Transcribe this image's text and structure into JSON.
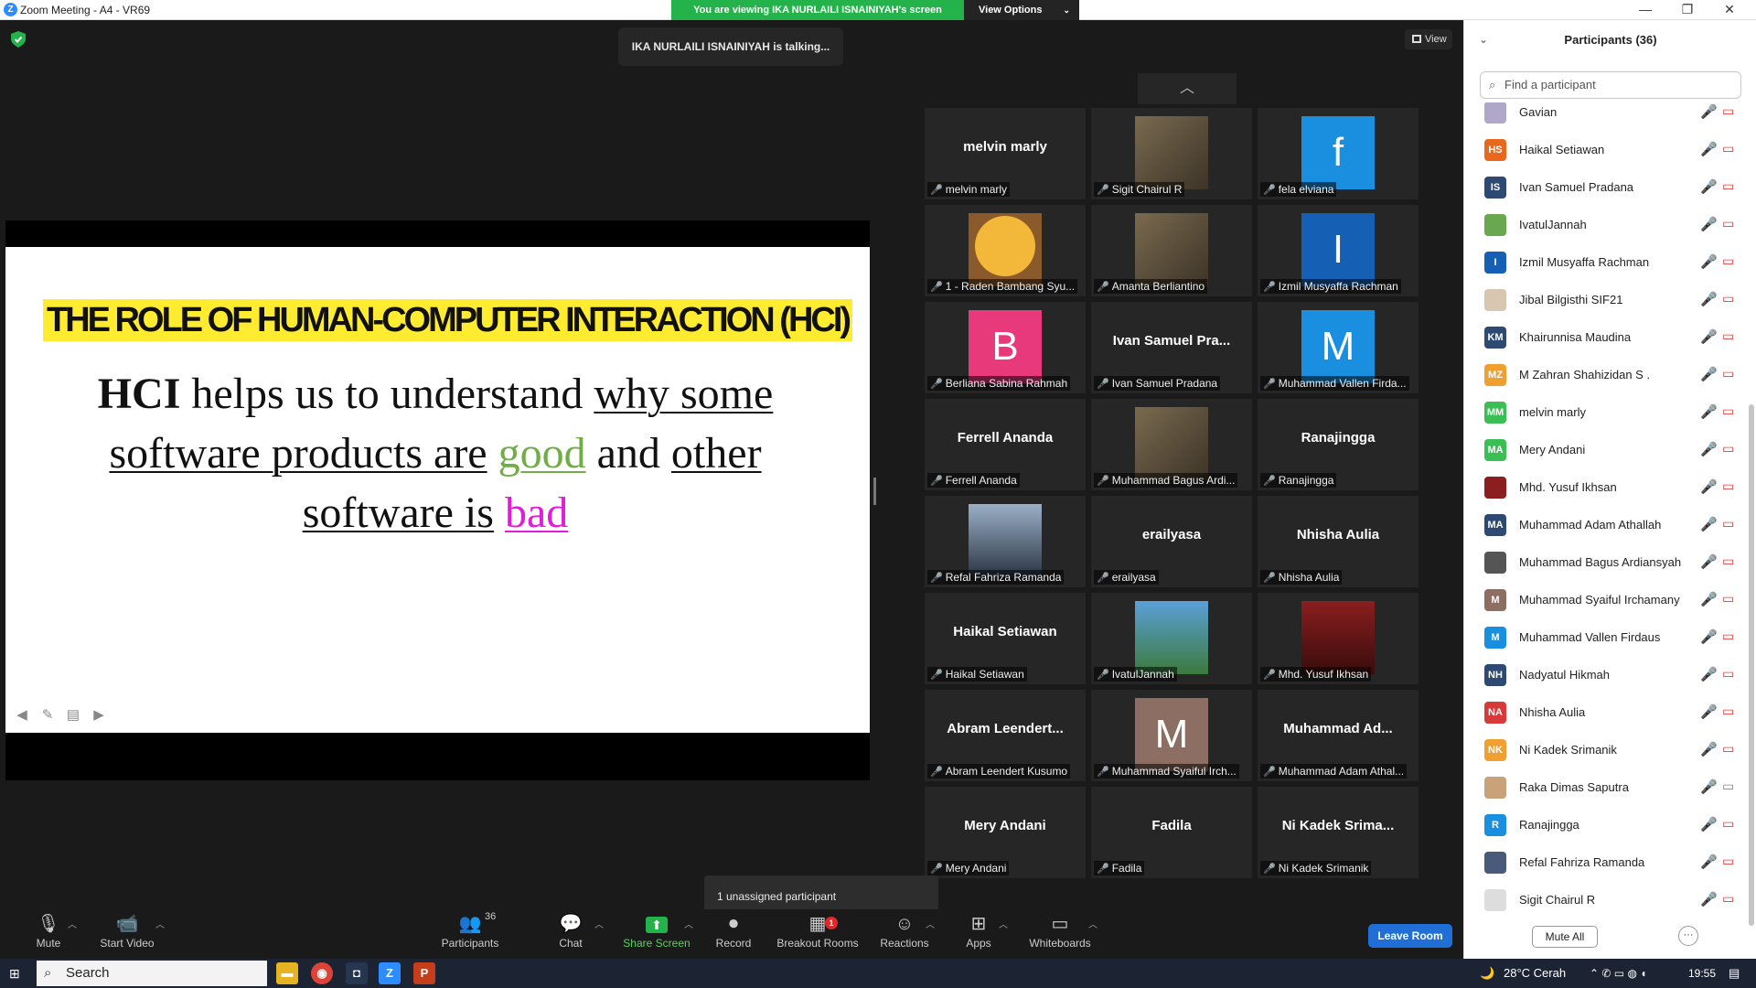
{
  "window": {
    "title": "Zoom Meeting - A4 - VR69",
    "minimize": "—",
    "restore": "❐",
    "close": "✕"
  },
  "banner": {
    "viewing": "You are viewing IKA NURLAILI ISNAINIYAH's screen",
    "view_options": "View Options"
  },
  "talking": "IKA NURLAILI ISNAINIYAH is talking...",
  "view_button": "View",
  "slide": {
    "title": "THE ROLE OF HUMAN-COMPUTER INTERACTION (HCI)",
    "body_hci": "HCI",
    "body_1": " helps us to understand ",
    "body_2": "why some software products are",
    "body_3": " ",
    "body_good": "good",
    "body_4": " and ",
    "body_5": "other software is",
    "body_6": " ",
    "body_bad": "bad",
    "colors": {
      "title_bg": "#ffec31",
      "good": "#70ad47",
      "bad": "#e31bdb"
    }
  },
  "gallery": {
    "tiles": [
      {
        "label": "melvin marly",
        "center": "melvin marly",
        "avatar": ""
      },
      {
        "label": "Sigit Chairul R",
        "center": "",
        "avatar": "photo"
      },
      {
        "label": "fela elviana",
        "center": "",
        "avatar": "f",
        "color": "#1a8fe0"
      },
      {
        "label": "1 - Raden Bambang Syu...",
        "center": "",
        "avatar": "photo-jake"
      },
      {
        "label": "Amanta Berliantino",
        "center": "",
        "avatar": "photo"
      },
      {
        "label": "Izmil Musyaffa Rachman",
        "center": "",
        "avatar": "I",
        "color": "#1560b5"
      },
      {
        "label": "Berliana Sabina Rahmah",
        "center": "",
        "avatar": "B",
        "color": "#e8397a"
      },
      {
        "label": "Ivan Samuel Pradana",
        "center": "Ivan Samuel Pra...",
        "avatar": ""
      },
      {
        "label": "Muhammad Vallen Firda...",
        "center": "",
        "avatar": "M",
        "color": "#1a8fe0"
      },
      {
        "label": "Ferrell Ananda",
        "center": "Ferrell Ananda",
        "avatar": ""
      },
      {
        "label": "Muhammad Bagus Ardi...",
        "center": "",
        "avatar": "photo"
      },
      {
        "label": "Ranajingga",
        "center": "Ranajingga",
        "avatar": ""
      },
      {
        "label": "Refal Fahriza Ramanda",
        "center": "",
        "avatar": "photo-bird"
      },
      {
        "label": "erailyasa",
        "center": "erailyasa",
        "avatar": ""
      },
      {
        "label": "Nhisha Aulia",
        "center": "Nhisha Aulia",
        "avatar": ""
      },
      {
        "label": "Haikal Setiawan",
        "center": "Haikal Setiawan",
        "avatar": ""
      },
      {
        "label": "IvatulJannah",
        "center": "",
        "avatar": "photo-cartoon"
      },
      {
        "label": "Mhd. Yusuf Ikhsan",
        "center": "",
        "avatar": "photo-red"
      },
      {
        "label": "Abram Leendert Kusumo",
        "center": "Abram  Leendert...",
        "avatar": ""
      },
      {
        "label": "Muhammad Syaiful Irch...",
        "center": "",
        "avatar": "M",
        "color": "#8d6e63"
      },
      {
        "label": "Muhammad Adam Athal...",
        "center": "Muhammad  Ad...",
        "avatar": ""
      },
      {
        "label": "Mery Andani",
        "center": "Mery Andani",
        "avatar": ""
      },
      {
        "label": "Fadila",
        "center": "Fadila",
        "avatar": ""
      },
      {
        "label": "Ni Kadek Srimanik",
        "center": "Ni  Kadek  Srima...",
        "avatar": ""
      }
    ]
  },
  "tooltip": "1 unassigned participant",
  "toolbar": {
    "mute": "Mute",
    "start_video": "Start Video",
    "participants": "Participants",
    "participants_count": "36",
    "chat": "Chat",
    "share_screen": "Share Screen",
    "record": "Record",
    "breakout_rooms": "Breakout Rooms",
    "breakout_badge": "1",
    "reactions": "Reactions",
    "apps": "Apps",
    "whiteboards": "Whiteboards",
    "leave_room": "Leave Room"
  },
  "panel": {
    "header": "Participants (36)",
    "search_placeholder": "Find a participant",
    "participants": [
      {
        "name": "Gavian",
        "initials": "",
        "color": "#b0a8c8"
      },
      {
        "name": "Haikal Setiawan",
        "initials": "HS",
        "color": "#e8681d"
      },
      {
        "name": "Ivan Samuel Pradana",
        "initials": "IS",
        "color": "#2f4a72"
      },
      {
        "name": "IvatulJannah",
        "initials": "",
        "color": "#6aa84f"
      },
      {
        "name": "Izmil Musyaffa Rachman",
        "initials": "I",
        "color": "#1560b5"
      },
      {
        "name": "Jibal Bilgisthi SIF21",
        "initials": "",
        "color": "#d9c6b0"
      },
      {
        "name": "Khairunnisa Maudina",
        "initials": "KM",
        "color": "#2f4a72"
      },
      {
        "name": "M Zahran Shahizidan S .",
        "initials": "MZ",
        "color": "#f0a030"
      },
      {
        "name": "melvin marly",
        "initials": "MM",
        "color": "#3bbf55"
      },
      {
        "name": "Mery Andani",
        "initials": "MA",
        "color": "#3bbf55"
      },
      {
        "name": "Mhd. Yusuf Ikhsan",
        "initials": "",
        "color": "#8b1f1f"
      },
      {
        "name": "Muhammad Adam Athallah",
        "initials": "MA",
        "color": "#2f4a72"
      },
      {
        "name": "Muhammad Bagus Ardiansyah",
        "initials": "",
        "color": "#555555"
      },
      {
        "name": "Muhammad Syaiful Irchamany",
        "initials": "M",
        "color": "#8d6e63"
      },
      {
        "name": "Muhammad Vallen Firdaus",
        "initials": "M",
        "color": "#1a8fe0"
      },
      {
        "name": "Nadyatul Hikmah",
        "initials": "NH",
        "color": "#2f4a72"
      },
      {
        "name": "Nhisha Aulia",
        "initials": "NA",
        "color": "#d83a3a"
      },
      {
        "name": "Ni Kadek Srimanik",
        "initials": "NK",
        "color": "#f0a030"
      },
      {
        "name": "Raka Dimas Saputra",
        "initials": "",
        "color": "#c9a27a",
        "video_on": true
      },
      {
        "name": "Ranajingga",
        "initials": "R",
        "color": "#1a8fe0"
      },
      {
        "name": "Refal Fahriza Ramanda",
        "initials": "",
        "color": "#4a5a7a"
      },
      {
        "name": "Sigit Chairul R",
        "initials": "",
        "color": "#dddddd"
      }
    ],
    "mute_all": "Mute All",
    "more": "···"
  },
  "taskbar": {
    "search": "Search",
    "weather": "28°C  Cerah",
    "time": "19:55"
  }
}
